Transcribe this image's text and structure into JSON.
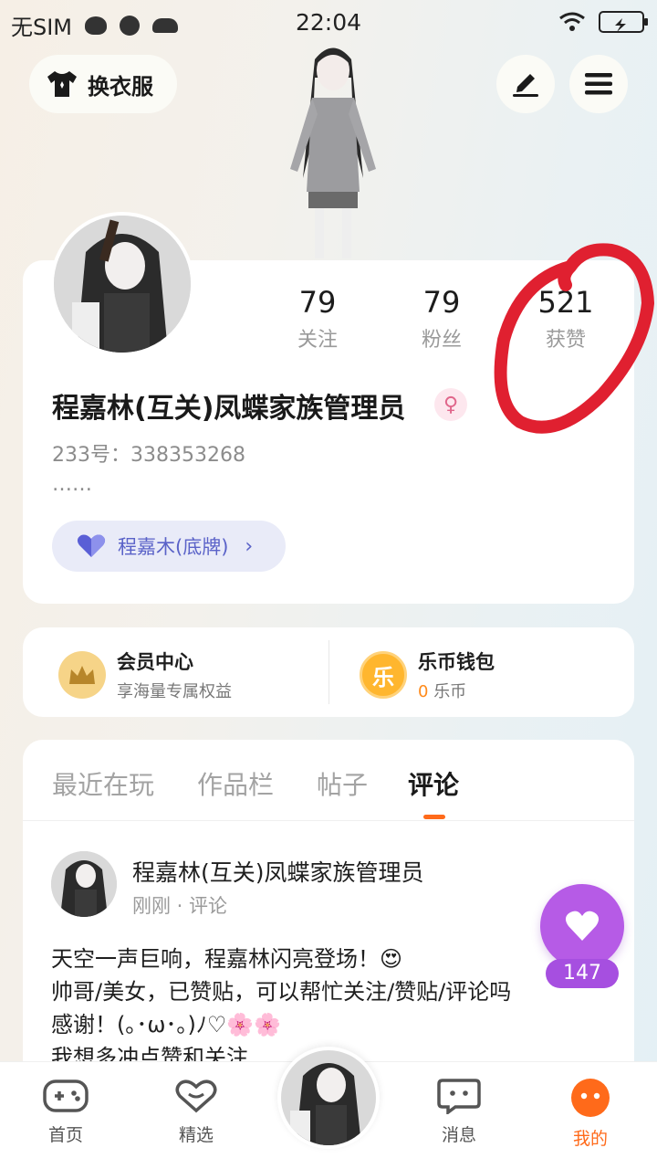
{
  "status_bar": {
    "carrier": "无SIM",
    "time": "22:04"
  },
  "header": {
    "outfit_label": "换衣服"
  },
  "profile": {
    "stats": [
      {
        "num": "79",
        "label": "关注"
      },
      {
        "num": "79",
        "label": "粉丝"
      },
      {
        "num": "521",
        "label": "获赞"
      }
    ],
    "username": "程嘉林(互关)凤蝶家族管理员",
    "gender_symbol": "♀",
    "uid": "233号：338353268",
    "bio": "……",
    "badge": "程嘉木(底牌)"
  },
  "member": {
    "vip_title": "会员中心",
    "vip_sub": "享海量专属权益",
    "wallet_icon": "乐",
    "wallet_title": "乐币钱包",
    "wallet_amount": "0",
    "wallet_unit": "乐币"
  },
  "tabs": [
    "最近在玩",
    "作品栏",
    "帖子",
    "评论"
  ],
  "post": {
    "name": "程嘉林(互关)凤蝶家族管理员",
    "meta": "刚刚 · 评论",
    "text": "天空一声巨响，程嘉林闪亮登场！😍\n帅哥/美女，已赞贴，可以帮忙关注/赞贴/评论吗\n感谢！(｡･ω･｡)ﾉ♡🌸🌸\n我想多冲点赞和关注"
  },
  "like_count": "147",
  "nav": [
    {
      "label": "首页"
    },
    {
      "label": "精选"
    },
    {
      "label": "消息"
    },
    {
      "label": "我的"
    }
  ],
  "colors": {
    "accent": "#ff6a1a",
    "like": "#b65be6",
    "badge_text": "#5a62c8"
  }
}
